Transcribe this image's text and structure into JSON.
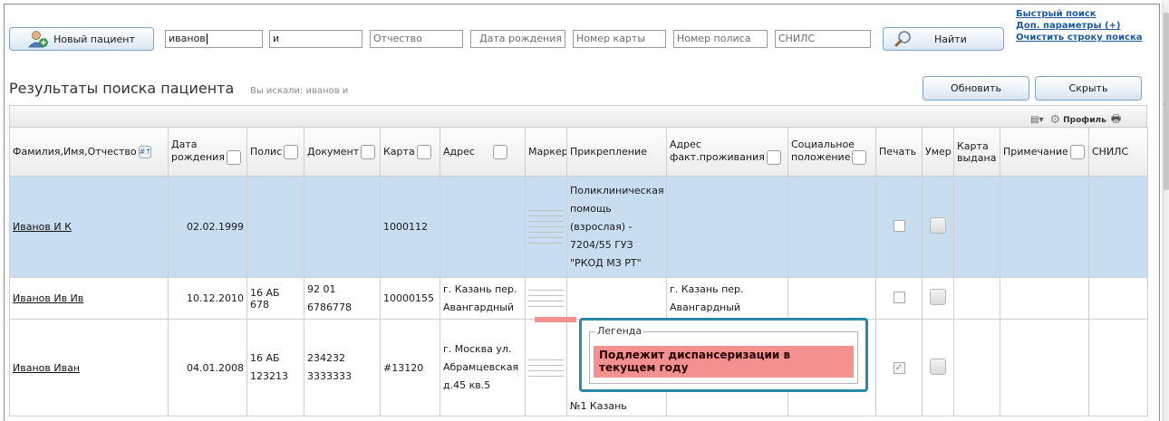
{
  "search": {
    "new_patient_label": "Новый пациент",
    "last_name_value": "иванов",
    "first_name_value": "и",
    "patronymic_placeholder": "Отчество",
    "birth_date_placeholder": "Дата рождения",
    "card_number_placeholder": "Номер карты",
    "policy_number_placeholder": "Номер полиса",
    "snils_placeholder": "СНИЛС",
    "find_label": "Найти",
    "links": [
      "Быстрый поиск",
      "Доп. параметры (+)",
      "Очистить строку поиска"
    ]
  },
  "results": {
    "title": "Результаты поиска пациента",
    "searched_for": "Вы искали: иванов и",
    "refresh_label": "Обновить",
    "hide_label": "Скрыть",
    "profile_label": "Профиль"
  },
  "table": {
    "columns": [
      "Фамилия,Имя,Отчество",
      "Дата рождения",
      "Полис",
      "Документ",
      "Карта",
      "Адрес",
      "Маркер",
      "Прикрепление",
      "Адрес факт.проживания",
      "Социальное положение",
      "Печать",
      "Умер",
      "Карта выдана",
      "Примечание",
      "СНИЛС"
    ],
    "rows": [
      {
        "name": "Иванов И К",
        "birth": "02.02.1999",
        "policy": "",
        "document": "",
        "card": "1000112",
        "address": "",
        "attachment": "Поликлиническая помощь (взрослая) - 7204/55 ГУЗ \"РКОД МЗ РТ\"",
        "actual_address": "",
        "social": "",
        "print_checked": false
      },
      {
        "name": "Иванов Ив Ив",
        "birth": "10.12.2010",
        "policy": "16 АБ 678",
        "document": "92 01 6786778",
        "card": "10000155",
        "address": "г. Казань пер. Авангардный",
        "attachment": "",
        "actual_address": "г. Казань пер. Авангардный",
        "social": "",
        "print_checked": false
      },
      {
        "name": "Иванов Иван",
        "birth": "04.01.2008",
        "policy": "16 АБ 123213",
        "document": "234232 3333333",
        "card": "#13120",
        "address": "г. Москва ул. Абрамцевская д.45 кв.5",
        "attachment": "№1 Казань",
        "actual_address": "",
        "social": "",
        "print_checked": true
      }
    ]
  },
  "legend": {
    "title": "Легенда",
    "item": "Подлежит диспансеризации в текущем году",
    "item_color": "#f29190"
  }
}
